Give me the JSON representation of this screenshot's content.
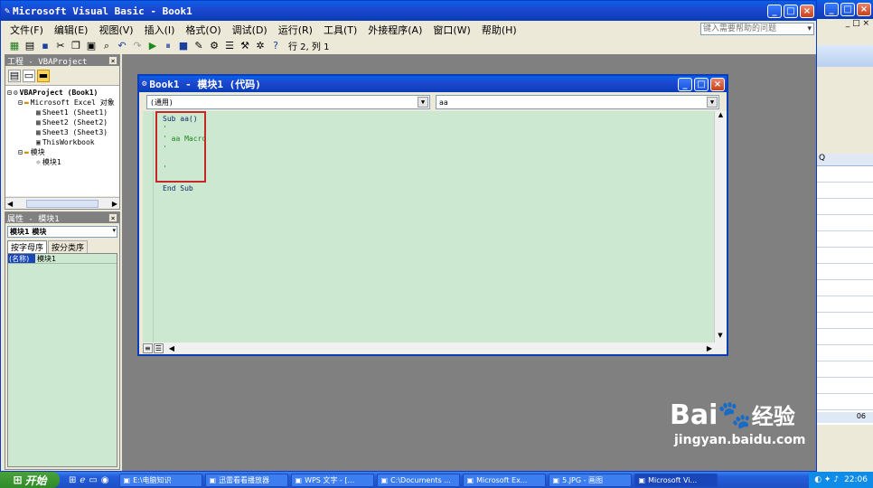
{
  "window": {
    "title": "Microsoft Visual Basic - Book1",
    "icon": "vba-app-icon"
  },
  "menu": [
    "文件(F)",
    "编辑(E)",
    "视图(V)",
    "插入(I)",
    "格式(O)",
    "调试(D)",
    "运行(R)",
    "工具(T)",
    "外接程序(A)",
    "窗口(W)",
    "帮助(H)"
  ],
  "help_box": "键入需要帮助的问题",
  "toolbar": {
    "cursor_pos": "行 2, 列 1"
  },
  "project": {
    "title": "工程 - VBAProject",
    "items": [
      {
        "label": "VBAProject (Book1)",
        "indent": 0,
        "icon": "vbaproject-icon",
        "expander": "-"
      },
      {
        "label": "Microsoft Excel 对象",
        "indent": 1,
        "icon": "folder-icon",
        "expander": "-"
      },
      {
        "label": "Sheet1 (Sheet1)",
        "indent": 2,
        "icon": "sheet-icon",
        "expander": ""
      },
      {
        "label": "Sheet2 (Sheet2)",
        "indent": 2,
        "icon": "sheet-icon",
        "expander": ""
      },
      {
        "label": "Sheet3 (Sheet3)",
        "indent": 2,
        "icon": "sheet-icon",
        "expander": ""
      },
      {
        "label": "ThisWorkbook",
        "indent": 2,
        "icon": "workbook-icon",
        "expander": ""
      },
      {
        "label": "模块",
        "indent": 1,
        "icon": "folder-icon",
        "expander": "-"
      },
      {
        "label": "模块1",
        "indent": 2,
        "icon": "module-icon",
        "expander": ""
      }
    ]
  },
  "properties": {
    "title": "属性 - 模块1",
    "object_select": "模块1 模块",
    "tabs": [
      "按字母序",
      "按分类序"
    ],
    "rows": [
      {
        "name": "(名称)",
        "value": "模块1"
      }
    ]
  },
  "code_window": {
    "title": "Book1 - 模块1 (代码)",
    "object_combo": "(通用)",
    "proc_combo": "aa",
    "lines": [
      {
        "text": "Sub aa()",
        "comment": false
      },
      {
        "text": "'",
        "comment": true
      },
      {
        "text": "' aa Macro",
        "comment": true
      },
      {
        "text": "'",
        "comment": true
      },
      {
        "text": "",
        "comment": false
      },
      {
        "text": "'",
        "comment": true
      },
      {
        "text": "",
        "comment": false
      },
      {
        "text": "End Sub",
        "comment": false
      }
    ]
  },
  "taskbar": {
    "start": "开始",
    "tasks": [
      {
        "label": "E:\\电脑知识",
        "active": false
      },
      {
        "label": "迅雷看看播放器",
        "active": false
      },
      {
        "label": "WPS 文字 - [...",
        "active": false
      },
      {
        "label": "C:\\Documents ...",
        "active": false
      },
      {
        "label": "Microsoft Ex...",
        "active": false
      },
      {
        "label": "5.JPG - 画图",
        "active": false
      },
      {
        "label": "Microsoft Vi...",
        "active": true
      }
    ],
    "clock": "22:06"
  },
  "excel": {
    "sheet_tab": "Q",
    "zoom_label": "06"
  },
  "watermark": {
    "brand": "Bai",
    "brand2": "经验",
    "url": "jingyan.baidu.com"
  },
  "colors": {
    "code_bg": "#cde8d0",
    "highlight_box": "#c62828",
    "title_blue": "#0a3db8"
  }
}
